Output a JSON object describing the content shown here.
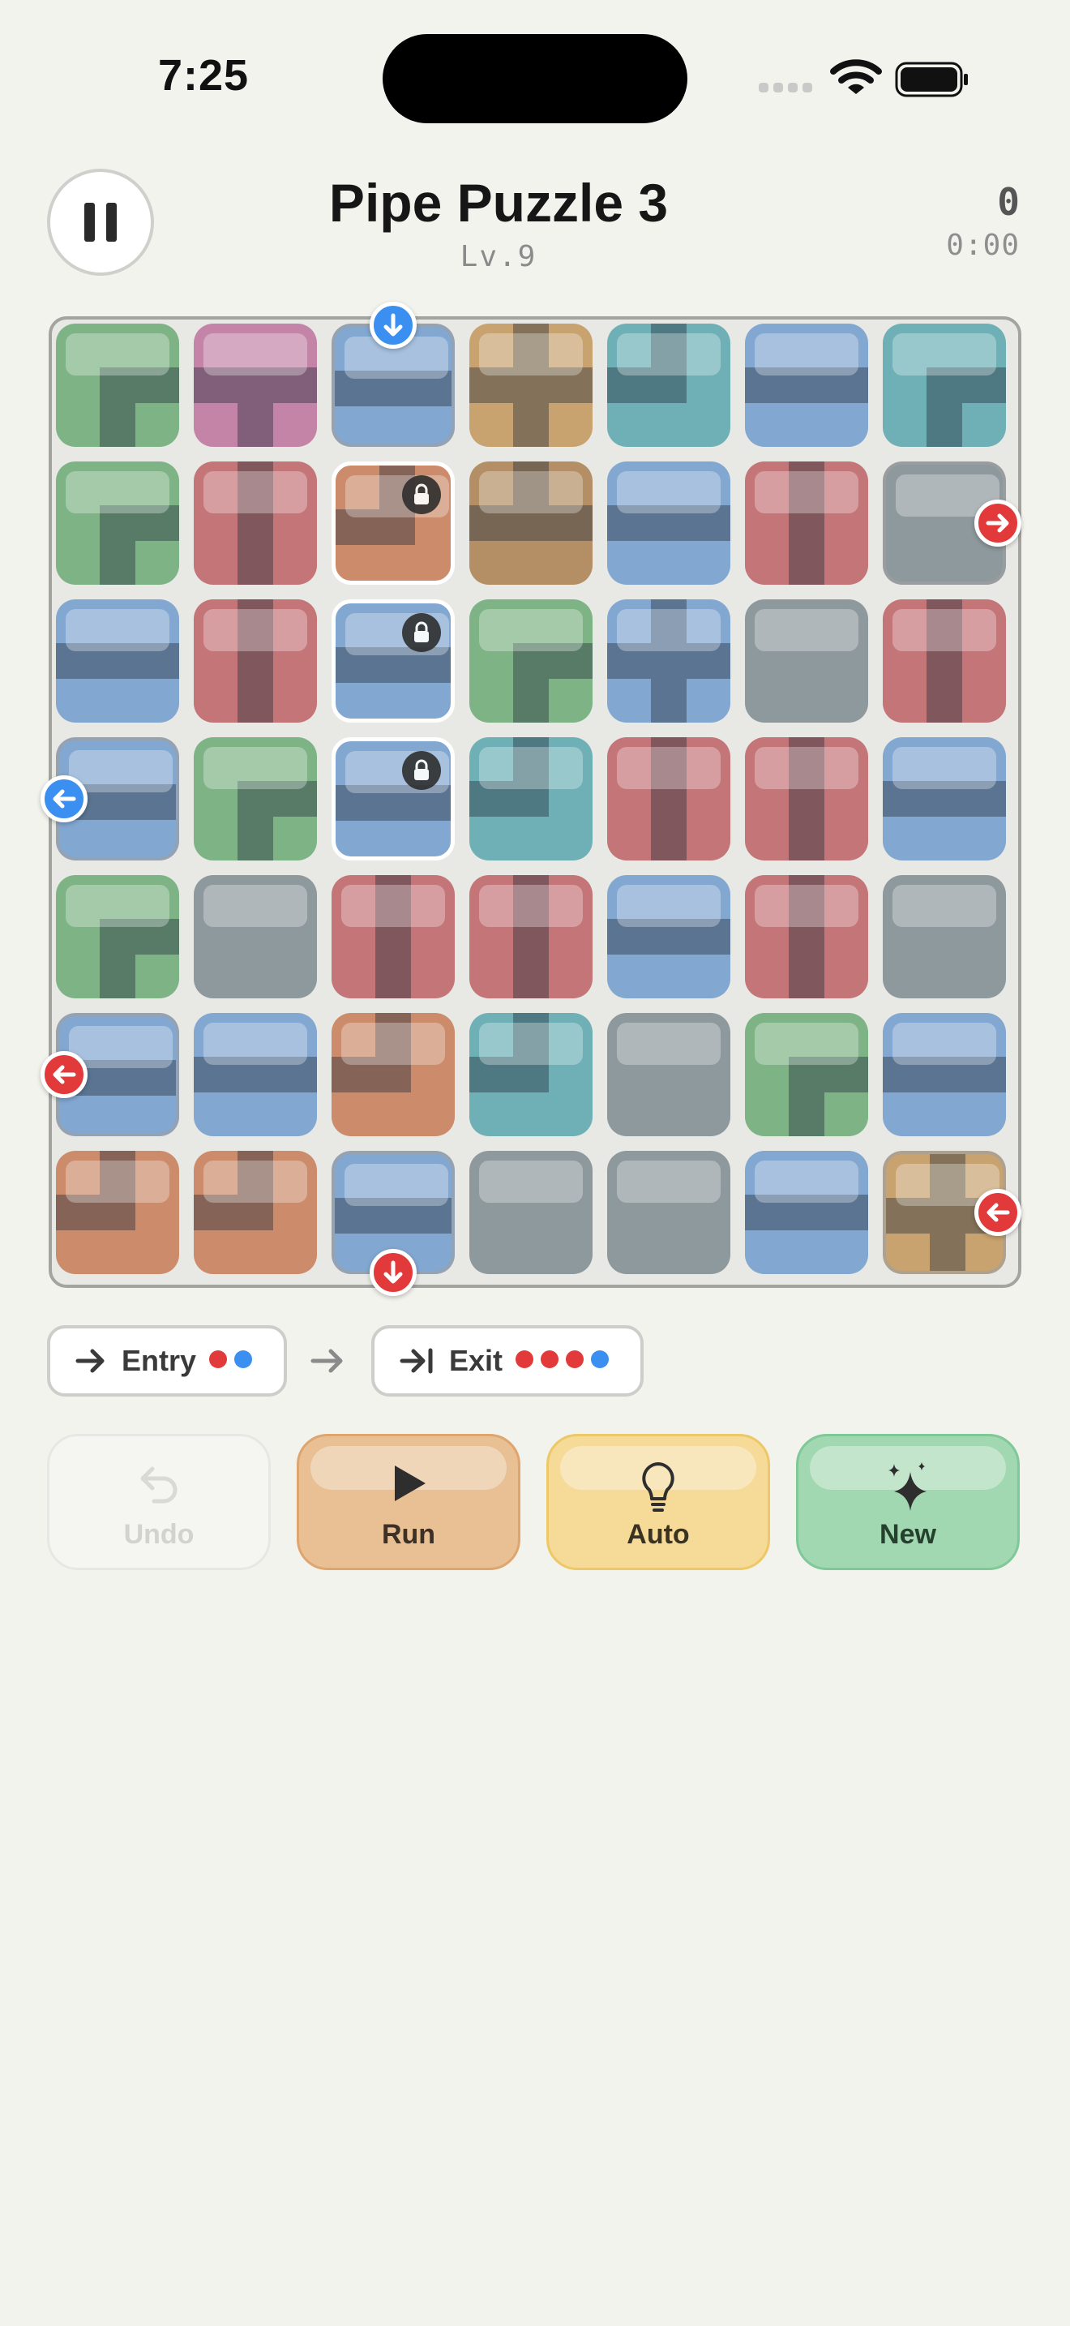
{
  "status_bar": {
    "time": "7:25"
  },
  "header": {
    "title": "Pipe Puzzle 3",
    "level": "Lv.9",
    "score": "0",
    "timer": "0:00"
  },
  "legend": {
    "entry_label": "Entry",
    "entry_dots": [
      "#e23a3a",
      "#3b8ff0"
    ],
    "exit_label": "Exit",
    "exit_dots": [
      "#e23a3a",
      "#e23a3a",
      "#e23a3a",
      "#3b8ff0"
    ]
  },
  "actions": {
    "undo": "Undo",
    "run": "Run",
    "auto": "Auto",
    "new": "New"
  },
  "colors": {
    "green": "#7db385",
    "pink": "#c484a8",
    "blue": "#82a7d1",
    "tan": "#c8a36f",
    "teal": "#6eb0b6",
    "red": "#c47578",
    "orange": "#cc8b6a",
    "brown": "#b48f65",
    "gray": "#8e999d",
    "port_red": "#e23a3a",
    "port_blue": "#3b8ff0"
  },
  "board": {
    "rows": 7,
    "cols": 7,
    "tiles": [
      [
        "green:corner-ne",
        "pink:tee-down",
        "blue:straight-h",
        "tan:cross",
        "teal:corner-nw",
        "blue:straight-h",
        "teal:corner-ne"
      ],
      [
        "green:corner-ne",
        "red:straight-v",
        "orange:corner-nw",
        "brown:tee-up",
        "blue:straight-h",
        "red:straight-v",
        "gray:blank"
      ],
      [
        "blue:straight-h",
        "red:straight-v",
        "blue:straight-h",
        "green:corner-ne",
        "blue:cross",
        "gray:blank",
        "red:straight-v"
      ],
      [
        "blue:straight-h",
        "green:corner-ne",
        "blue:straight-h",
        "teal:corner-nw",
        "red:straight-v",
        "red:straight-v",
        "blue:straight-h"
      ],
      [
        "green:corner-ne",
        "gray:blank",
        "red:straight-v",
        "red:straight-v",
        "blue:straight-h",
        "red:straight-v",
        "gray:blank"
      ],
      [
        "blue:straight-h",
        "blue:straight-h",
        "orange:corner-nw",
        "teal:corner-nw",
        "gray:blank",
        "green:corner-ne",
        "blue:straight-h"
      ],
      [
        "orange:corner-nw",
        "orange:corner-nw",
        "blue:straight-h",
        "gray:blank",
        "gray:blank",
        "blue:straight-h",
        "tan:cross"
      ]
    ],
    "locked": [
      [
        1,
        2
      ],
      [
        2,
        2
      ],
      [
        3,
        2
      ]
    ],
    "ring": [
      [
        0,
        2
      ],
      [
        1,
        6
      ],
      [
        3,
        0
      ],
      [
        5,
        0
      ],
      [
        6,
        2
      ],
      [
        6,
        6
      ]
    ],
    "ports": [
      {
        "row": 0,
        "col": 2,
        "side": "top",
        "dir": "down",
        "color": "blue"
      },
      {
        "row": 1,
        "col": 6,
        "side": "right",
        "dir": "right",
        "color": "red"
      },
      {
        "row": 3,
        "col": 0,
        "side": "left",
        "dir": "left",
        "color": "blue"
      },
      {
        "row": 5,
        "col": 0,
        "side": "left",
        "dir": "left",
        "color": "red"
      },
      {
        "row": 6,
        "col": 2,
        "side": "bottom",
        "dir": "down",
        "color": "red"
      },
      {
        "row": 6,
        "col": 6,
        "side": "right",
        "dir": "left",
        "color": "red"
      }
    ]
  }
}
